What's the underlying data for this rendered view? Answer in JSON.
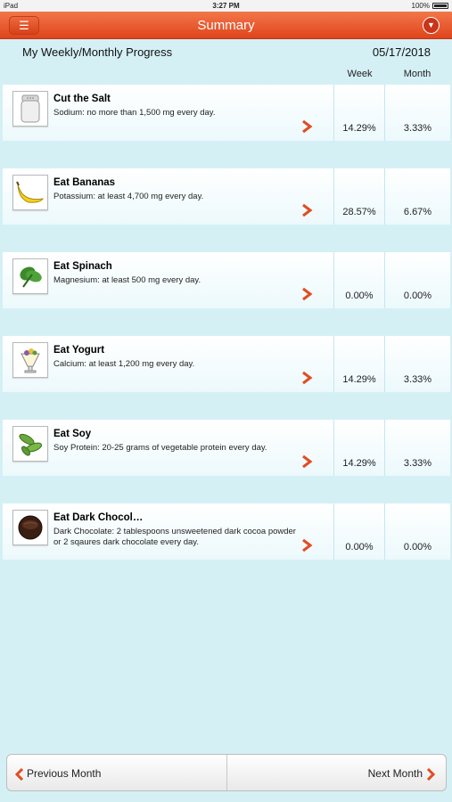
{
  "status_bar": {
    "device": "iPad",
    "time": "3:27 PM",
    "battery": "100%"
  },
  "header": {
    "title": "Summary",
    "menu_icon": "hamburger-icon",
    "dropdown_icon": "chevron-down-icon"
  },
  "summary": {
    "heading": "My Weekly/Monthly Progress",
    "date": "05/17/2018",
    "week_header": "Week",
    "month_header": "Month"
  },
  "items": [
    {
      "title": "Cut the Salt",
      "description": "Sodium: no more than 1,500 mg every day.",
      "week": "14.29%",
      "month": "3.33%",
      "icon": "salt-shaker-icon"
    },
    {
      "title": "Eat Bananas",
      "description": "Potassium: at least 4,700 mg every day.",
      "week": "28.57%",
      "month": "6.67%",
      "icon": "banana-icon"
    },
    {
      "title": "Eat Spinach",
      "description": "Magnesium: at least 500 mg every day.",
      "week": "0.00%",
      "month": "0.00%",
      "icon": "spinach-icon"
    },
    {
      "title": "Eat Yogurt",
      "description": "Calcium: at least 1,200 mg every day.",
      "week": "14.29%",
      "month": "3.33%",
      "icon": "yogurt-icon"
    },
    {
      "title": "Eat Soy",
      "description": "Soy Protein: 20-25 grams of vegetable protein every day.",
      "week": "14.29%",
      "month": "3.33%",
      "icon": "soybean-icon"
    },
    {
      "title": "Eat Dark Chocol…",
      "description": "Dark Chocolate: 2 tablespoons unsweetened dark cocoa powder or 2 sqaures dark chocolate every day.",
      "week": "0.00%",
      "month": "0.00%",
      "icon": "chocolate-icon"
    }
  ],
  "footer": {
    "prev_label": "Previous Month",
    "next_label": "Next Month"
  },
  "colors": {
    "accent": "#e24c22",
    "background": "#d5f0f5"
  }
}
